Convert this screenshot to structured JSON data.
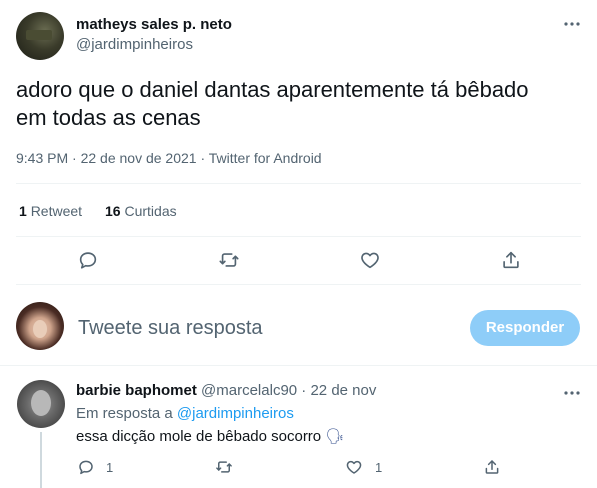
{
  "main_tweet": {
    "author_name": "matheys sales p. neto",
    "author_handle": "@jardimpinheiros",
    "text_line1": "adoro que o daniel dantas aparentemente tá bêbado",
    "text_line2": "em todas as cenas",
    "meta": "9:43 PM · 22 de nov de 2021 · Twitter for Android",
    "stats": {
      "retweet_count": "1",
      "retweet_label": "Retweet",
      "like_count": "16",
      "like_label": "Curtidas"
    }
  },
  "reply_box": {
    "placeholder": "Tweete sua resposta",
    "button_label": "Responder"
  },
  "reply": {
    "author_name": "barbie baphomet",
    "author_handle": "@marcelalc90",
    "separator": "·",
    "date": "22 de nov",
    "replying_to_prefix": "Em resposta a",
    "replying_to_handle": "@jardimpinheiros",
    "text": "essa dicção mole de bêbado socorro",
    "emoji": "🗣",
    "reply_count": "1",
    "like_count": "1"
  },
  "colors": {
    "accent": "#1d9bf0",
    "button_disabled": "#8ecdf8",
    "muted_text": "#536471",
    "divider": "#eff3f4"
  },
  "icons": [
    "more-icon",
    "reply-icon",
    "retweet-icon",
    "like-icon",
    "share-icon"
  ]
}
